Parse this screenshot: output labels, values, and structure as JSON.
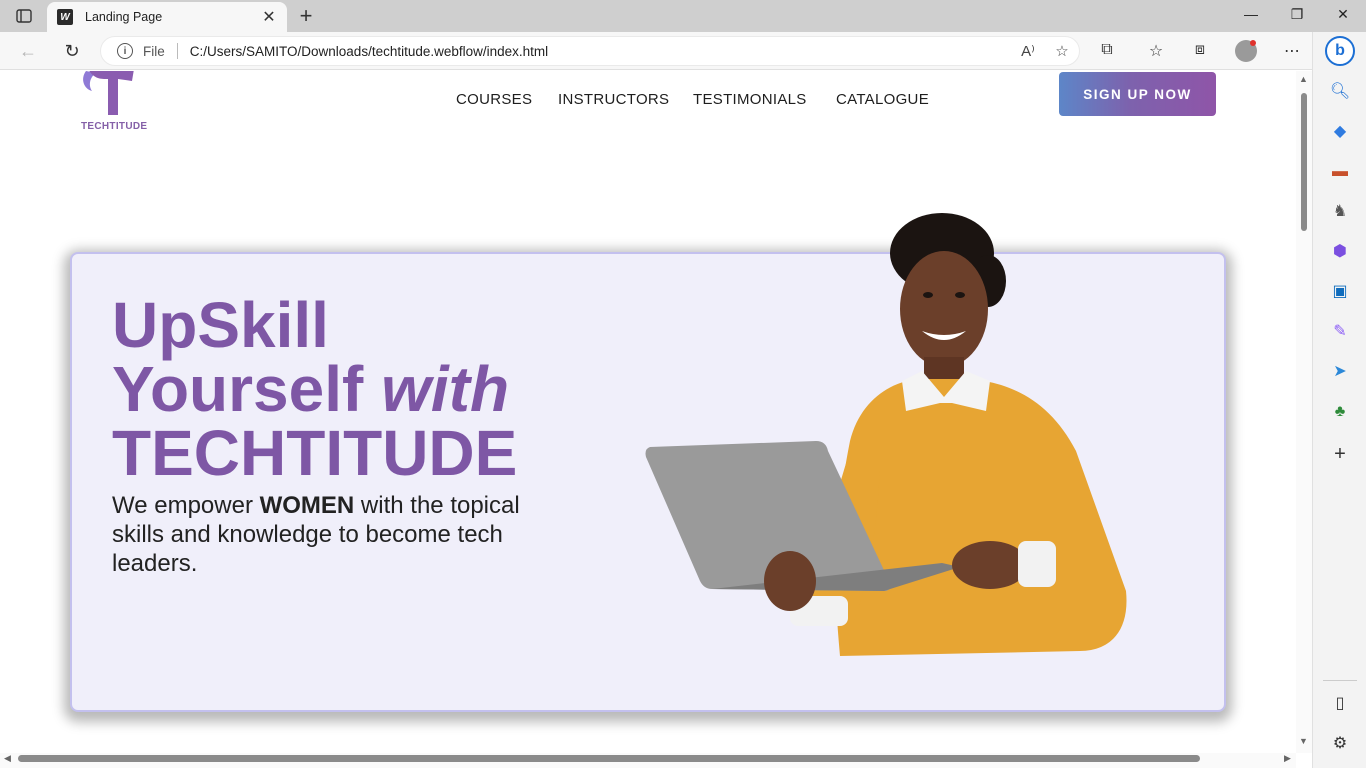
{
  "browser": {
    "tab_title": "Landing Page",
    "favicon_letter": "W",
    "address_scheme": "File",
    "address_url": "C:/Users/SAMITO/Downloads/techtitude.webflow/index.html"
  },
  "page": {
    "logo_text": "TECHTITUDE",
    "nav": [
      "COURSES",
      "INSTRUCTORS",
      "TESTIMONIALS",
      "CATALOGUE"
    ],
    "signup_label": "SIGN UP NOW",
    "headline_line1": "UpSkill",
    "headline_line2a": "Yourself ",
    "headline_line2b": "with",
    "headline_line3": "TECHTITUDE",
    "sub_a": "We empower ",
    "sub_b": "WOMEN",
    "sub_c": " with the topical skills and knowledge to become tech leaders."
  },
  "colors": {
    "brand_purple": "#7e57a5",
    "hero_bg": "#f0effa",
    "hero_border": "#c3c0ee",
    "sweater": "#e7a533",
    "laptop": "#9a9a9a"
  },
  "icons": {
    "toolbar": [
      "back-arrow-icon",
      "refresh-icon",
      "info-icon",
      "read-aloud-icon",
      "add-favorite-icon",
      "extensions-icon",
      "favorites-icon",
      "collections-icon",
      "profile-icon",
      "more-icon"
    ],
    "sidebar": [
      "bing-icon",
      "search-icon",
      "shopping-tag-icon",
      "tools-icon",
      "games-icon",
      "office-icon",
      "outlook-icon",
      "designer-icon",
      "send-icon",
      "tree-icon",
      "add-icon",
      "sidebar-toggle-icon",
      "settings-icon"
    ]
  }
}
